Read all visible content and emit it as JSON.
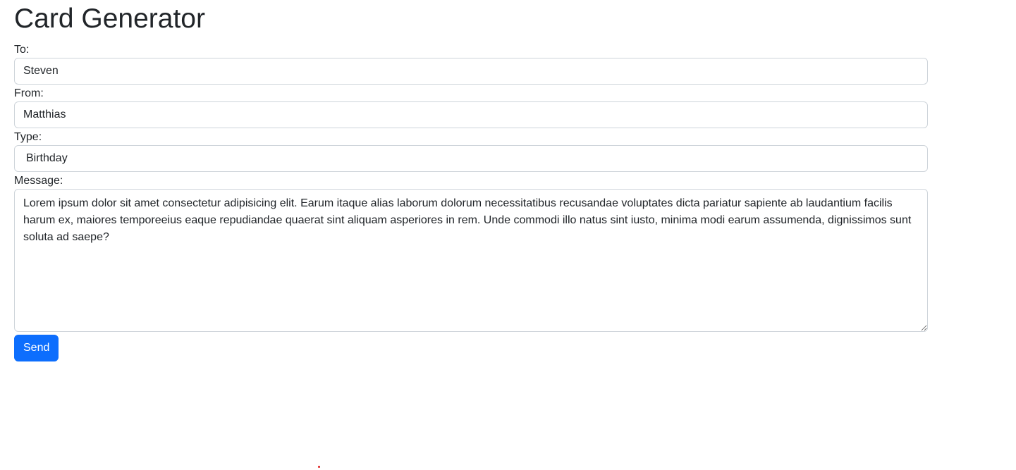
{
  "page": {
    "title": "Card Generator"
  },
  "form": {
    "to": {
      "label": "To:",
      "value": "Steven"
    },
    "from": {
      "label": "From:",
      "value": "Matthias"
    },
    "type": {
      "label": "Type:",
      "value": "Birthday"
    },
    "message": {
      "label": "Message:",
      "value": "Lorem ipsum dolor sit amet consectetur adipisicing elit. Earum itaque alias laborum dolorum necessitatibus recusandae voluptates dicta pariatur sapiente ab laudantium facilis harum ex, maiores temporeeius eaque repudiandae quaerat sint aliquam asperiores in rem. Unde commodi illo natus sint iusto, minima modi earum assumenda, dignissimos sunt soluta ad saepe?"
    },
    "send_label": "Send"
  },
  "colors": {
    "primary": "#0d6efd",
    "border": "#ced4da",
    "text": "#212529"
  }
}
